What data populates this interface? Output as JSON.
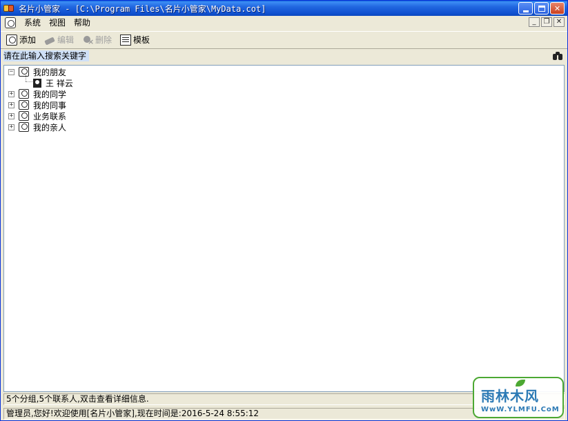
{
  "window": {
    "title": "名片小管家 - [C:\\Program Files\\名片小管家\\MyData.cot]",
    "title_icon": "contacts-app-icon",
    "controls": {
      "minimize": "minimize-icon",
      "maximize": "maximize-icon",
      "close": "close-icon"
    },
    "accent_color": "#0a5fd6"
  },
  "menubar": {
    "items": [
      {
        "label": "系统"
      },
      {
        "label": "视图"
      },
      {
        "label": "帮助"
      }
    ]
  },
  "toolbar": {
    "items": [
      {
        "label": "添加",
        "icon": "add-card-icon",
        "enabled": true
      },
      {
        "label": "编辑",
        "icon": "edit-icon",
        "enabled": false
      },
      {
        "label": "删除",
        "icon": "delete-icon",
        "enabled": false
      },
      {
        "label": "模板",
        "icon": "template-icon",
        "enabled": true
      }
    ]
  },
  "search": {
    "placeholder": "请在此输入搜索关键字",
    "value": "",
    "icon": "binoculars-icon"
  },
  "tree": {
    "groups": [
      {
        "label": "我的朋友",
        "expanded": true,
        "expander": "−",
        "children": [
          {
            "label": "王 祥云"
          }
        ]
      },
      {
        "label": "我的同学",
        "expanded": false,
        "expander": "+"
      },
      {
        "label": "我的同事",
        "expanded": false,
        "expander": "+"
      },
      {
        "label": "业务联系",
        "expanded": false,
        "expander": "+"
      },
      {
        "label": "我的亲人",
        "expanded": false,
        "expander": "+"
      }
    ]
  },
  "status": {
    "info": "5个分组,5个联系人,双击查看详细信息.",
    "welcome": "管理员,您好!欢迎使用[名片小管家],现在时间是:2016-5-24 8:55:12"
  },
  "watermark": {
    "main": "雨林木风",
    "sub": "WwW.YLMFU.CoM"
  }
}
